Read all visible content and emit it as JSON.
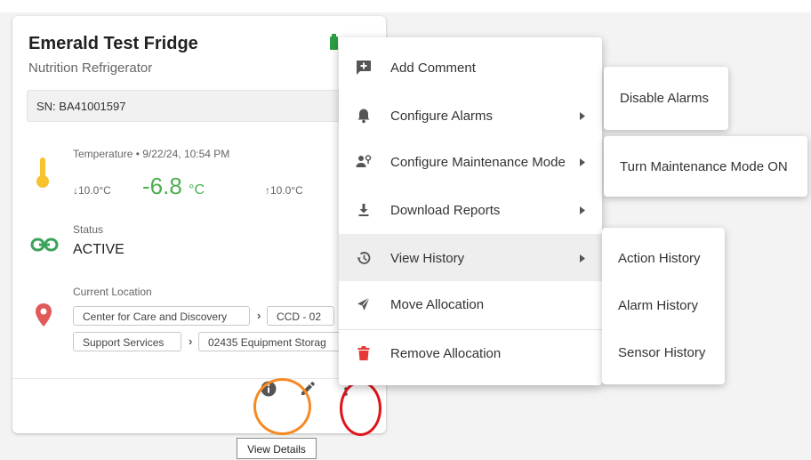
{
  "device": {
    "name": "Emerald Test Fridge",
    "type": "Nutrition Refrigerator",
    "serial": "SN: BA41001597",
    "battery_icon": "battery-full-icon",
    "temperature": {
      "label": "Temperature • 9/22/24, 10:54 PM",
      "min": "↓10.0°C",
      "value": "-6.8",
      "unit": "°C",
      "max": "↑10.0°C"
    },
    "status": {
      "label": "Status",
      "value": "ACTIVE"
    },
    "location": {
      "label": "Current Location",
      "path": [
        "Center for Care and Discovery",
        "CCD - 02",
        "Support Services",
        "02435 Equipment Storag"
      ],
      "separator": "›"
    }
  },
  "card_actions": {
    "info": "info-icon",
    "edit": "pencil-icon",
    "more": "more-vert-icon"
  },
  "tooltip": "View Details",
  "menu": {
    "items": [
      {
        "label": "Add Comment",
        "icon": "add-comment-icon",
        "has_submenu": false
      },
      {
        "label": "Configure Alarms",
        "icon": "bell-icon",
        "has_submenu": true
      },
      {
        "label": "Configure Maintenance Mode",
        "icon": "maintenance-person-icon",
        "has_submenu": true
      },
      {
        "label": "Download Reports",
        "icon": "download-icon",
        "has_submenu": true
      },
      {
        "label": "View History",
        "icon": "history-icon",
        "has_submenu": true,
        "hovered": true
      },
      {
        "label": "Move Allocation",
        "icon": "move-allocation-icon",
        "has_submenu": false
      },
      {
        "label": "Remove Allocation",
        "icon": "trash-icon",
        "has_submenu": false
      }
    ]
  },
  "submenus": {
    "alarms": [
      "Disable Alarms"
    ],
    "maintenance": [
      "Turn Maintenance Mode ON"
    ],
    "history": [
      "Action History",
      "Alarm History",
      "Sensor History"
    ]
  },
  "colors": {
    "temperature": "#4caf50",
    "battery": "#2e9e44",
    "thermometer": "#f6c22e",
    "location_pin": "#e05a5a",
    "link_icon": "#3aa35a",
    "trash": "#e53935",
    "annotation_orange": "#f58a25",
    "annotation_red": "#e0141c"
  }
}
